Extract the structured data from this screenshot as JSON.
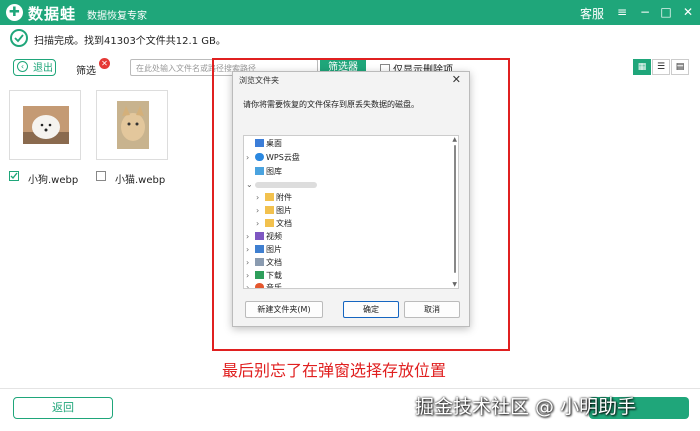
{
  "app": {
    "brand": "数据蛙",
    "subtitle": "数据恢复专家",
    "service_label": "客服",
    "window_controls": {
      "menu": "≡",
      "minimize": "−",
      "maximize": "□",
      "close": "✕"
    }
  },
  "status": {
    "text": "扫描完成。找到41303个文件共12.1 GB。"
  },
  "toolbar": {
    "exit_label": "退出",
    "filter_label": "筛选",
    "search_placeholder": "在此处输入文件名或路径搜索路径",
    "filter_button": "筛选器",
    "only_deleted_label": "仅显示删除项"
  },
  "files": [
    {
      "name": "小狗.webp",
      "checked": true
    },
    {
      "name": "小猫.webp",
      "checked": false
    }
  ],
  "dialog": {
    "title": "浏览文件夹",
    "description": "请你将需要恢复的文件保存到原丢失数据的磁盘。",
    "tree": [
      {
        "label": "桌面",
        "icon": "desktop-icon"
      },
      {
        "label": "WPS云盘",
        "icon": "cloud-icon"
      },
      {
        "label": "图库",
        "icon": "gallery-icon"
      },
      {
        "label": "附件",
        "icon": "folder-icon"
      },
      {
        "label": "图片",
        "icon": "folder-icon"
      },
      {
        "label": "文档",
        "icon": "folder-icon"
      },
      {
        "label": "视频",
        "icon": "video-icon"
      },
      {
        "label": "图片",
        "icon": "pictures-icon"
      },
      {
        "label": "文档",
        "icon": "documents-icon"
      },
      {
        "label": "下载",
        "icon": "download-icon"
      },
      {
        "label": "音乐",
        "icon": "music-icon"
      }
    ],
    "new_folder_button": "新建文件夹(M)",
    "ok_button": "确定",
    "cancel_button": "取消"
  },
  "caption": "最后别忘了在弹窗选择存放位置",
  "bottom": {
    "back_button": "返回"
  },
  "watermark": "掘金技术社区 @ 小明助手",
  "colors": {
    "brand_green": "#1fa67a",
    "highlight_red": "#e02020"
  }
}
